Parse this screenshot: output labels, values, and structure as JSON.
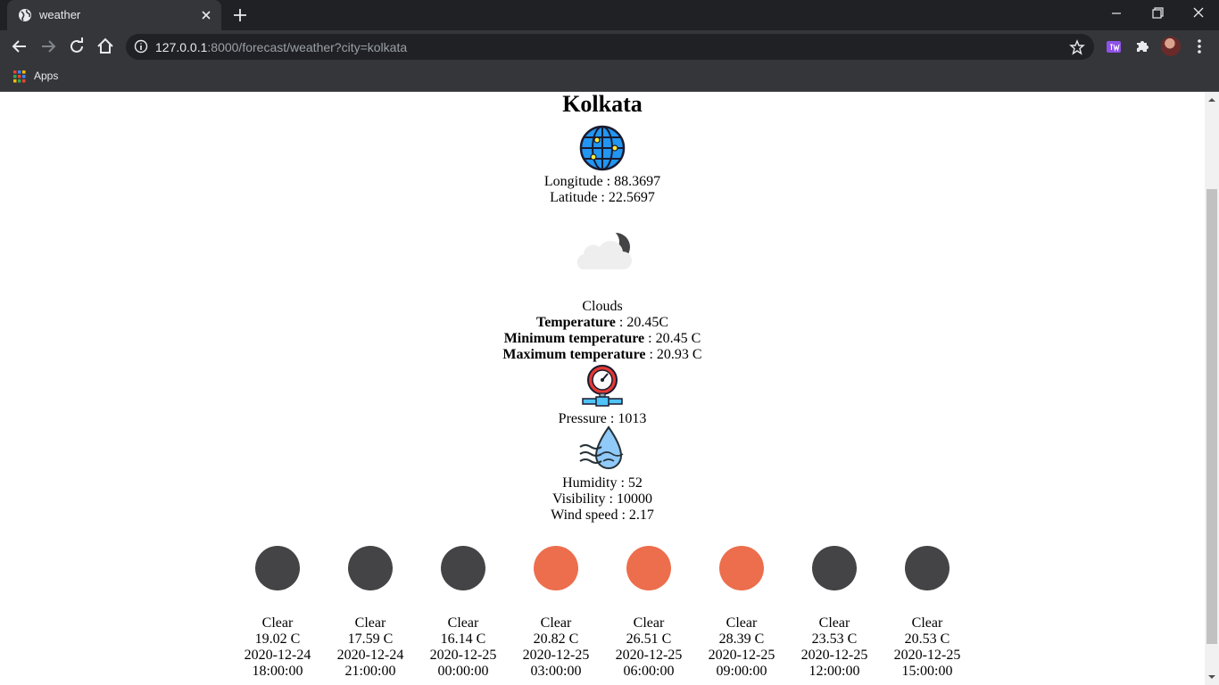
{
  "browser": {
    "tab_title": "weather",
    "url_host": "127.0.0.1",
    "url_rest": ":8000/forecast/weather?city=kolkata",
    "bookmarks": {
      "apps_label": "Apps"
    }
  },
  "page": {
    "city": "Kolkata",
    "longitude": "Longitude : 88.3697",
    "latitude": "Latitude : 22.5697",
    "condition": "Clouds",
    "temperature_label": "Temperature",
    "temperature_value": " : 20.45C",
    "min_temp_label": "Minimum temperature",
    "min_temp_value": " : 20.45 C",
    "max_temp_label": "Maximum temperature",
    "max_temp_value": " : 20.93 C",
    "pressure": "Pressure : 1013",
    "humidity": "Humidity : 52",
    "visibility": "Visibility : 10000",
    "wind_speed": "Wind speed : 2.17"
  },
  "forecast": [
    {
      "condition": "Clear",
      "temp": "19.02 C",
      "date": "2020-12-24",
      "time": "18:00:00",
      "icon": "moon-icon",
      "color": "#444446"
    },
    {
      "condition": "Clear",
      "temp": "17.59 C",
      "date": "2020-12-24",
      "time": "21:00:00",
      "icon": "moon-icon",
      "color": "#444446"
    },
    {
      "condition": "Clear",
      "temp": "16.14 C",
      "date": "2020-12-25",
      "time": "00:00:00",
      "icon": "moon-icon",
      "color": "#444446"
    },
    {
      "condition": "Clear",
      "temp": "20.82 C",
      "date": "2020-12-25",
      "time": "03:00:00",
      "icon": "sun-icon",
      "color": "#ec6e4c"
    },
    {
      "condition": "Clear",
      "temp": "26.51 C",
      "date": "2020-12-25",
      "time": "06:00:00",
      "icon": "sun-icon",
      "color": "#ec6e4c"
    },
    {
      "condition": "Clear",
      "temp": "28.39 C",
      "date": "2020-12-25",
      "time": "09:00:00",
      "icon": "sun-icon",
      "color": "#ec6e4c"
    },
    {
      "condition": "Clear",
      "temp": "23.53 C",
      "date": "2020-12-25",
      "time": "12:00:00",
      "icon": "moon-icon",
      "color": "#444446"
    },
    {
      "condition": "Clear",
      "temp": "20.53 C",
      "date": "2020-12-25",
      "time": "15:00:00",
      "icon": "moon-icon",
      "color": "#444446"
    }
  ]
}
